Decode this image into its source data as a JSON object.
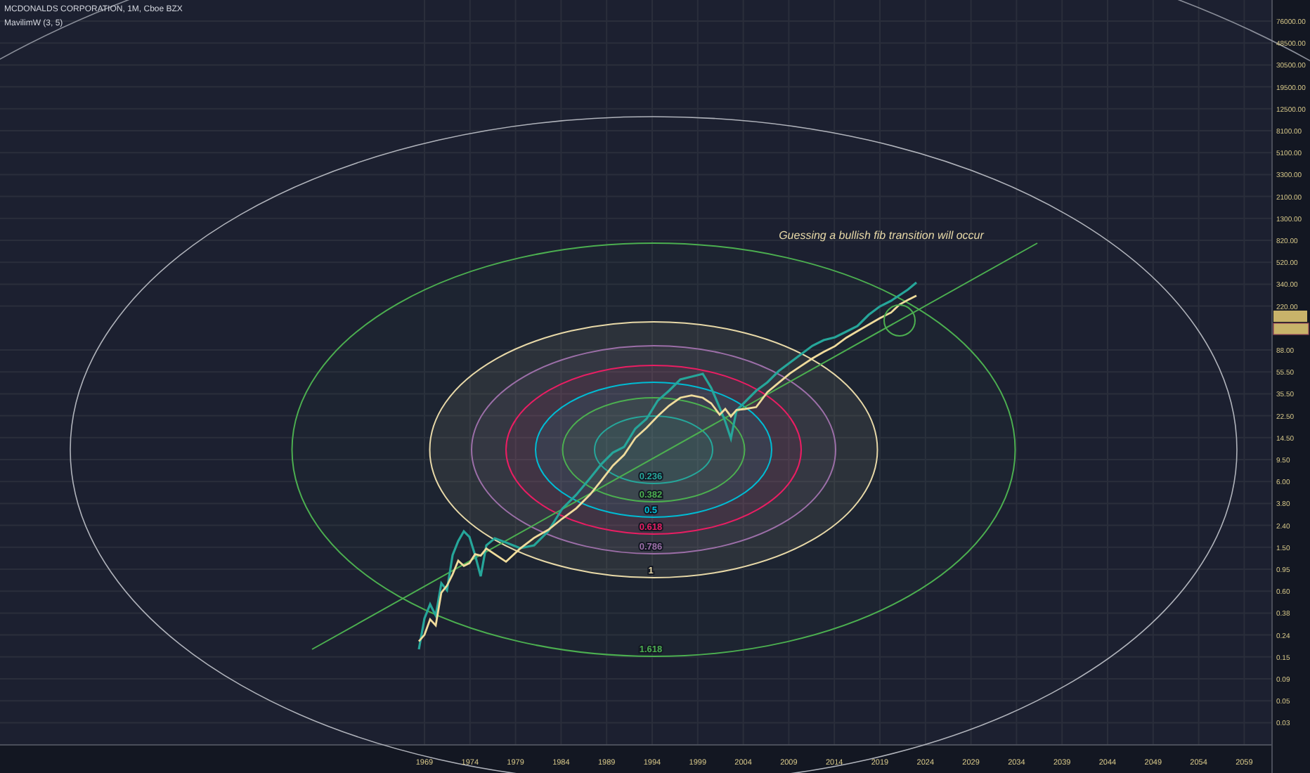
{
  "legend": {
    "symbol": "MCDONALDS CORPORATION, 1M, Cboe BZX",
    "indicator": "MavilimW (3, 5)"
  },
  "annotation": "Guessing a bullish fib transition will occur",
  "fib_levels": [
    {
      "label": "0.236",
      "color": "#26a69a"
    },
    {
      "label": "0.382",
      "color": "#4caf50"
    },
    {
      "label": "0.5",
      "color": "#00bcd4"
    },
    {
      "label": "0.618",
      "color": "#e91e63"
    },
    {
      "label": "0.786",
      "color": "#9c6fa8"
    },
    {
      "label": "1",
      "color": "#e8d9a8"
    },
    {
      "label": "1.618",
      "color": "#4caf50"
    }
  ],
  "price_axis": [
    "76000.00",
    "48500.00",
    "30500.00",
    "19500.00",
    "12500.00",
    "8100.00",
    "5100.00",
    "3300.00",
    "2100.00",
    "1300.00",
    "820.00",
    "520.00",
    "340.00",
    "220.00",
    "88.00",
    "55.50",
    "35.50",
    "22.50",
    "14.50",
    "9.50",
    "6.00",
    "3.80",
    "2.40",
    "1.50",
    "0.95",
    "0.60",
    "0.38",
    "0.24",
    "0.15",
    "0.09",
    "0.05",
    "0.03"
  ],
  "time_axis": [
    "1969",
    "1974",
    "1979",
    "1984",
    "1989",
    "1994",
    "1999",
    "2004",
    "2009",
    "2014",
    "2019",
    "2024",
    "2029",
    "2034",
    "2039",
    "2044",
    "2049",
    "2054",
    "2059"
  ]
}
